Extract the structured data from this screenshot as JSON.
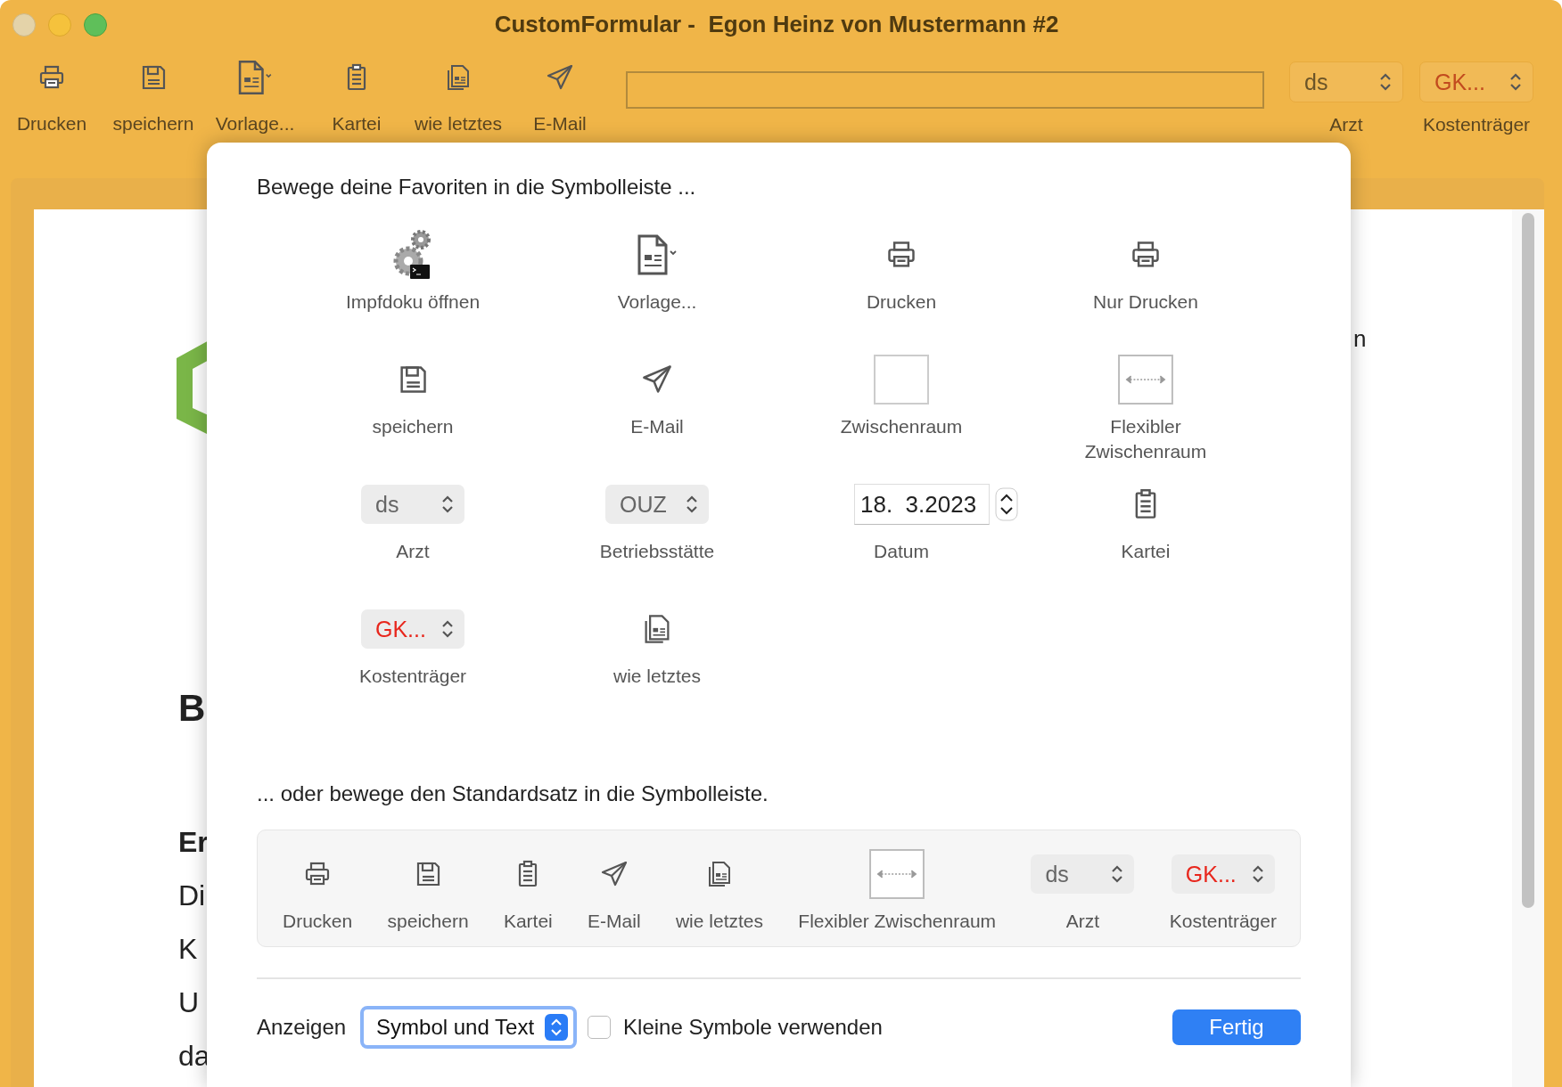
{
  "window": {
    "title": "CustomFormular -  Egon Heinz von Mustermann #2"
  },
  "toolbar": {
    "items": [
      {
        "kind": "print",
        "label": "Drucken"
      },
      {
        "kind": "save",
        "label": "speichern"
      },
      {
        "kind": "template",
        "label": "Vorlage..."
      },
      {
        "kind": "cards",
        "label": "Kartei"
      },
      {
        "kind": "copy",
        "label": "wie letztes"
      },
      {
        "kind": "mail",
        "label": "E-Mail"
      },
      {
        "kind": "field"
      },
      {
        "kind": "popup",
        "value": "ds",
        "label": "Arzt",
        "warning": false
      },
      {
        "kind": "popup",
        "value": "GK...",
        "label": "Kostenträger",
        "warning": true
      }
    ]
  },
  "document": {
    "fragments": [
      "B",
      "Er",
      "Di",
      "K",
      "U",
      "da"
    ],
    "right_fragment": "n"
  },
  "sheet": {
    "favorites_title": "Bewege deine Favoriten in die Symbolleiste ...",
    "favorites": [
      {
        "kind": "script",
        "label": "Impfdoku öffnen"
      },
      {
        "kind": "template",
        "label": "Vorlage..."
      },
      {
        "kind": "print",
        "label": "Drucken"
      },
      {
        "kind": "print",
        "label": "Nur Drucken"
      },
      {
        "kind": "save",
        "label": "speichern"
      },
      {
        "kind": "mail",
        "label": "E-Mail"
      },
      {
        "kind": "space",
        "label": "Zwischenraum"
      },
      {
        "kind": "flexspace",
        "label": "Flexibler Zwischenraum"
      },
      {
        "kind": "popup",
        "value": "ds",
        "label": "Arzt",
        "warning": false
      },
      {
        "kind": "popup",
        "value": "OUZ",
        "label": "Betriebsstätte",
        "warning": false
      },
      {
        "kind": "date",
        "value": "18.  3.2023",
        "label": "Datum"
      },
      {
        "kind": "cards",
        "label": "Kartei"
      },
      {
        "kind": "popup",
        "value": "GK...",
        "label": "Kostenträger",
        "warning": true
      },
      {
        "kind": "copy",
        "label": "wie letztes"
      }
    ],
    "default_title": "... oder bewege den Standardsatz in die Symbolleiste.",
    "default_set": [
      {
        "kind": "print",
        "label": "Drucken"
      },
      {
        "kind": "save",
        "label": "speichern"
      },
      {
        "kind": "cards",
        "label": "Kartei"
      },
      {
        "kind": "mail",
        "label": "E-Mail"
      },
      {
        "kind": "copy",
        "label": "wie letztes"
      },
      {
        "kind": "flexspace",
        "label": "Flexibler Zwischenraum"
      },
      {
        "kind": "popup",
        "value": "ds",
        "label": "Arzt",
        "warning": false
      },
      {
        "kind": "popup",
        "value": "GK...",
        "label": "Kostenträger",
        "warning": true
      }
    ],
    "show_label": "Anzeigen",
    "show_value": "Symbol und Text",
    "small_icons": {
      "label": "Kleine Symbole verwenden",
      "checked": false
    },
    "done": "Fertig"
  }
}
